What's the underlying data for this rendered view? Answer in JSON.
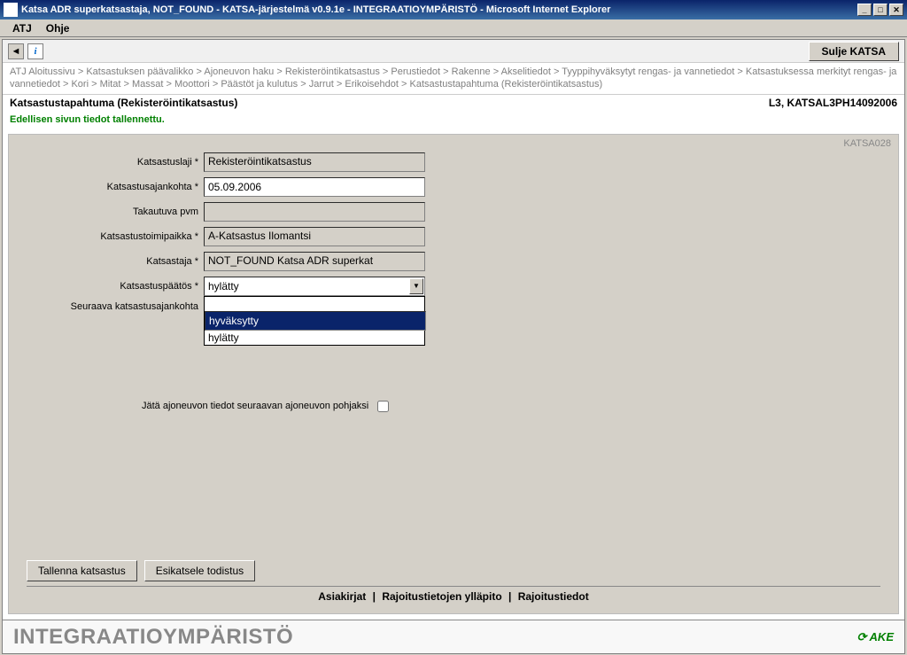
{
  "window": {
    "title": "Katsa ADR superkatsastaja, NOT_FOUND - KATSA-järjestelmä v0.9.1e - INTEGRAATIOYMPÄRISTÖ - Microsoft Internet Explorer"
  },
  "menu": {
    "atj": "ATJ",
    "ohje": "Ohje"
  },
  "toolbar": {
    "close": "Sulje KATSA"
  },
  "breadcrumb": [
    "ATJ Aloitussivu",
    "Katsastuksen päävalikko",
    "Ajoneuvon haku",
    "Rekisteröintikatsastus",
    "Perustiedot",
    "Rakenne",
    "Akselitiedot",
    "Tyyppihyväksytyt rengas- ja vannetiedot",
    "Katsastuksessa merkityt rengas- ja vannetiedot",
    "Kori",
    "Mitat",
    "Massat",
    "Moottori",
    "Päästöt ja kulutus",
    "Jarrut",
    "Erikoisehdot",
    "Katsastustapahtuma (Rekisteröintikatsastus)"
  ],
  "page": {
    "title": "Katsastustapahtuma (Rekisteröintikatsastus)",
    "context": "L3, KATSAL3PH14092006",
    "status": "Edellisen sivun tiedot tallennettu.",
    "code": "KATSA028"
  },
  "form": {
    "katsastuslaji": {
      "label": "Katsastuslaji *",
      "value": "Rekisteröintikatsastus"
    },
    "ajankohta": {
      "label": "Katsastusajankohta *",
      "value": "05.09.2006"
    },
    "takautuva": {
      "label": "Takautuva pvm",
      "value": ""
    },
    "toimipaikka": {
      "label": "Katsastustoimipaikka *",
      "value": "A-Katsastus Ilomantsi"
    },
    "katsastaja": {
      "label": "Katsastaja *",
      "value": "NOT_FOUND Katsa ADR superkat"
    },
    "paatos": {
      "label": "Katsastuspäätös *",
      "value": "hylätty",
      "options": [
        "",
        "hyväksytty",
        "hylätty"
      ],
      "selected_index": 1
    },
    "seuraava": {
      "label": "Seuraava katsastusajankohta"
    },
    "jata": {
      "label": "Jätä ajoneuvon tiedot seuraavan ajoneuvon pohjaksi"
    }
  },
  "buttons": {
    "tallenna": "Tallenna katsastus",
    "esikatsele": "Esikatsele todistus"
  },
  "links": {
    "asiakirjat": "Asiakirjat",
    "rajoitusyp": "Rajoitustietojen ylläpito",
    "rajoitus": "Rajoitustiedot"
  },
  "footer": {
    "env": "INTEGRAATIOYMPÄRISTÖ",
    "logo": "AKE"
  }
}
